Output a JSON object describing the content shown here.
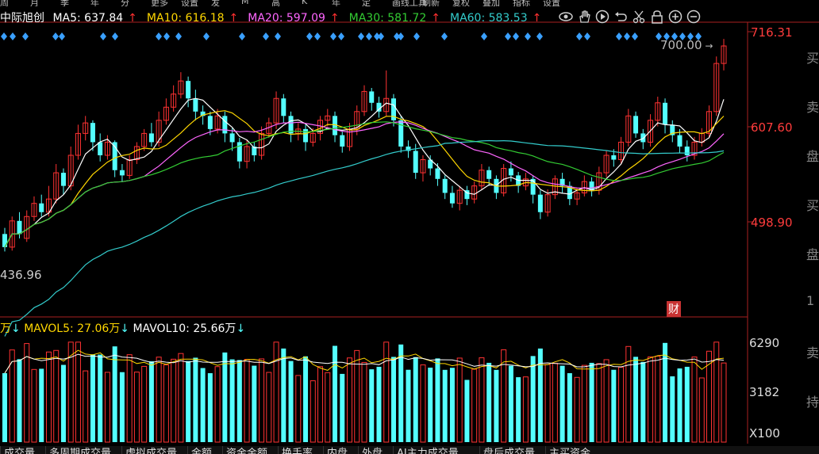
{
  "top_tabs": [
    "周",
    "月",
    "季",
    "年",
    "分",
    "更多",
    "设置",
    "发",
    "M",
    "高",
    "K",
    "年",
    "定",
    "画线工具",
    "刷新",
    "复权",
    "叠加",
    "指标",
    "设置"
  ],
  "stock_name": "中际旭创",
  "ma": [
    {
      "label": "MA5: 637.84",
      "color": "#ffffff"
    },
    {
      "label": "MA10: 616.18",
      "color": "#ffd700"
    },
    {
      "label": "MA20: 597.09",
      "color": "#ff66ff"
    },
    {
      "label": "MA30: 581.72",
      "color": "#33cc33"
    },
    {
      "label": "MA60: 583.53",
      "color": "#33cccc"
    }
  ],
  "arrow_up": "↑",
  "arrow_down": "↓",
  "tools": [
    "eye-icon",
    "hand-icon",
    "play-icon",
    "undo-icon",
    "scissors-icon",
    "lock-icon",
    "zoom-in-icon",
    "zoom-out-icon"
  ],
  "price_axis": [
    "716.31",
    "607.60",
    "498.90"
  ],
  "high_annotation": "700.00",
  "low_annotation": "436.96",
  "fin_badge": "财",
  "volume_legend": {
    "unit": "万",
    "mavol5": "MAVOL5: 27.06万",
    "mavol10": "MAVOL10: 25.66万"
  },
  "volume_axis": [
    "6290",
    "3182",
    "X100"
  ],
  "right_strip": [
    "买",
    "卖",
    "盘",
    "买",
    "盘",
    "1",
    "卖",
    "持"
  ],
  "bottom_tabs": [
    "成交量",
    "多周期成交量",
    "虚拟成交量",
    "金额",
    "资金金额",
    "换手率",
    "内盘",
    "外盘",
    "AI主力成交量",
    "盘后成交量",
    "主买资金"
  ],
  "colors": {
    "up": "#ff3232",
    "down": "#54ffff",
    "ma5": "#ffffff",
    "ma10": "#ffd700",
    "ma20": "#ff66ff",
    "ma30": "#33cc33",
    "ma60": "#33cccc",
    "diamond": "#3aa0ff"
  },
  "chart_data": {
    "type": "candlestick",
    "price_axis_ticks": [
      716.31,
      607.6,
      498.9
    ],
    "volume_axis_ticks": [
      6290,
      3182
    ],
    "volume_unit": "X100",
    "candles": [
      [
        485,
        470,
        492,
        465
      ],
      [
        470,
        500,
        505,
        466
      ],
      [
        500,
        485,
        510,
        480
      ],
      [
        480,
        505,
        512,
        476
      ],
      [
        505,
        520,
        528,
        500
      ],
      [
        520,
        510,
        530,
        505
      ],
      [
        510,
        525,
        540,
        505
      ],
      [
        525,
        555,
        565,
        520
      ],
      [
        555,
        540,
        560,
        530
      ],
      [
        540,
        575,
        585,
        535
      ],
      [
        575,
        600,
        610,
        570
      ],
      [
        600,
        612,
        620,
        592
      ],
      [
        612,
        590,
        615,
        580
      ],
      [
        590,
        575,
        600,
        568
      ],
      [
        575,
        590,
        598,
        570
      ],
      [
        590,
        558,
        592,
        550
      ],
      [
        558,
        552,
        565,
        545
      ],
      [
        552,
        570,
        575,
        548
      ],
      [
        570,
        585,
        590,
        565
      ],
      [
        585,
        600,
        605,
        580
      ],
      [
        600,
        590,
        612,
        585
      ],
      [
        590,
        615,
        625,
        585
      ],
      [
        615,
        630,
        640,
        610
      ],
      [
        630,
        645,
        655,
        625
      ],
      [
        645,
        660,
        670,
        640
      ],
      [
        660,
        640,
        665,
        630
      ],
      [
        640,
        625,
        650,
        615
      ],
      [
        625,
        620,
        632,
        610
      ],
      [
        620,
        605,
        625,
        598
      ],
      [
        605,
        620,
        628,
        600
      ],
      [
        620,
        600,
        625,
        590
      ],
      [
        600,
        590,
        606,
        580
      ],
      [
        590,
        568,
        595,
        560
      ],
      [
        568,
        585,
        592,
        560
      ],
      [
        585,
        575,
        590,
        568
      ],
      [
        575,
        600,
        608,
        570
      ],
      [
        600,
        612,
        618,
        595
      ],
      [
        612,
        640,
        648,
        605
      ],
      [
        640,
        620,
        645,
        612
      ],
      [
        620,
        600,
        625,
        590
      ],
      [
        600,
        605,
        612,
        592
      ],
      [
        605,
        590,
        610,
        580
      ],
      [
        590,
        600,
        606,
        585
      ],
      [
        600,
        615,
        620,
        592
      ],
      [
        615,
        620,
        628,
        608
      ],
      [
        620,
        598,
        625,
        590
      ],
      [
        598,
        585,
        602,
        578
      ],
      [
        585,
        605,
        612,
        580
      ],
      [
        605,
        625,
        632,
        598
      ],
      [
        625,
        648,
        655,
        620
      ],
      [
        648,
        635,
        652,
        626
      ],
      [
        635,
        625,
        642,
        618
      ],
      [
        625,
        640,
        672,
        620
      ],
      [
        640,
        615,
        645,
        608
      ],
      [
        615,
        585,
        620,
        578
      ],
      [
        585,
        580,
        592,
        572
      ],
      [
        580,
        555,
        588,
        548
      ],
      [
        555,
        570,
        575,
        545
      ],
      [
        570,
        560,
        575,
        552
      ],
      [
        560,
        548,
        566,
        540
      ],
      [
        548,
        532,
        552,
        525
      ],
      [
        532,
        520,
        540,
        515
      ],
      [
        520,
        535,
        540,
        512
      ],
      [
        535,
        525,
        540,
        518
      ],
      [
        525,
        540,
        545,
        520
      ],
      [
        540,
        558,
        565,
        535
      ],
      [
        558,
        548,
        562,
        540
      ],
      [
        548,
        532,
        552,
        525
      ],
      [
        532,
        560,
        565,
        528
      ],
      [
        560,
        552,
        568,
        545
      ],
      [
        552,
        540,
        556,
        532
      ],
      [
        540,
        548,
        555,
        535
      ],
      [
        548,
        530,
        552,
        520
      ],
      [
        530,
        510,
        535,
        502
      ],
      [
        510,
        530,
        536,
        505
      ],
      [
        530,
        548,
        552,
        525
      ],
      [
        548,
        540,
        555,
        532
      ],
      [
        540,
        525,
        545,
        518
      ],
      [
        525,
        532,
        538,
        518
      ],
      [
        532,
        545,
        552,
        528
      ],
      [
        545,
        535,
        550,
        528
      ],
      [
        535,
        555,
        562,
        530
      ],
      [
        555,
        575,
        580,
        550
      ],
      [
        575,
        570,
        582,
        562
      ],
      [
        570,
        590,
        596,
        565
      ],
      [
        590,
        620,
        628,
        585
      ],
      [
        620,
        600,
        625,
        595
      ],
      [
        600,
        590,
        605,
        582
      ],
      [
        590,
        615,
        622,
        585
      ],
      [
        615,
        635,
        642,
        608
      ],
      [
        635,
        610,
        640,
        600
      ],
      [
        610,
        598,
        615,
        590
      ],
      [
        598,
        585,
        605,
        578
      ],
      [
        585,
        575,
        592,
        568
      ],
      [
        575,
        590,
        596,
        570
      ],
      [
        590,
        600,
        606,
        585
      ],
      [
        600,
        625,
        632,
        595
      ],
      [
        625,
        680,
        688,
        620
      ],
      [
        680,
        700,
        708,
        672
      ]
    ]
  }
}
